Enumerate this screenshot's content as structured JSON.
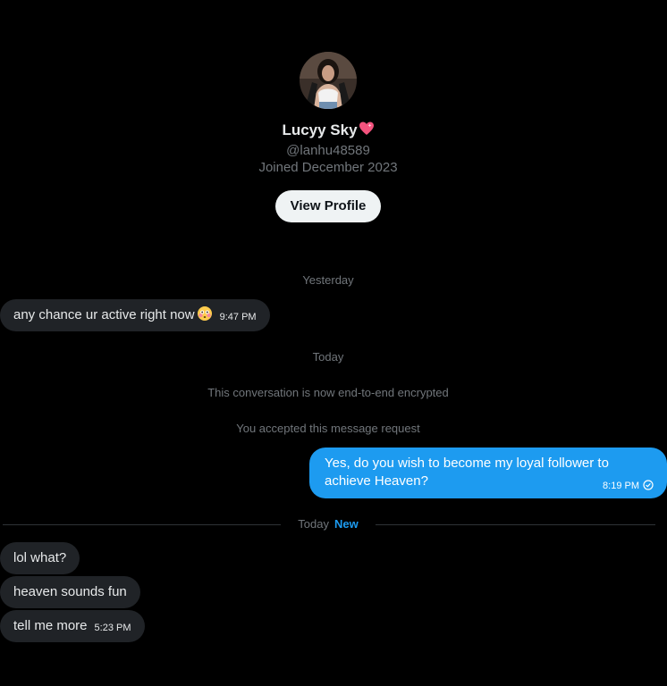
{
  "profile": {
    "display_name": "Lucyy Sky",
    "name_emoji": "sparkling-heart-icon",
    "handle": "@lanhu48589",
    "joined": "Joined December 2023",
    "view_profile_label": "View Profile"
  },
  "separators": {
    "yesterday": "Yesterday",
    "today": "Today",
    "encrypted_notice": "This conversation is now end-to-end encrypted",
    "accepted_notice": "You accepted this message request",
    "today_divider": "Today",
    "new_label": "New"
  },
  "messages": {
    "m1": {
      "text": "any chance ur active right now",
      "time": "9:47 PM",
      "emoji": "flushed-face-icon"
    },
    "m2": {
      "text": "Yes, do you wish to become my loyal follower to achieve Heaven?",
      "time": "8:19 PM",
      "status": "sent-check-icon"
    },
    "m3": {
      "text": "lol what?"
    },
    "m4": {
      "text": "heaven sounds fun"
    },
    "m5": {
      "text": "tell me more",
      "time": "5:23 PM"
    }
  },
  "colors": {
    "background": "#000000",
    "incoming_bubble": "#202327",
    "outgoing_bubble": "#1d9bf0",
    "muted_text": "#71767b",
    "accent": "#1d9bf0"
  }
}
